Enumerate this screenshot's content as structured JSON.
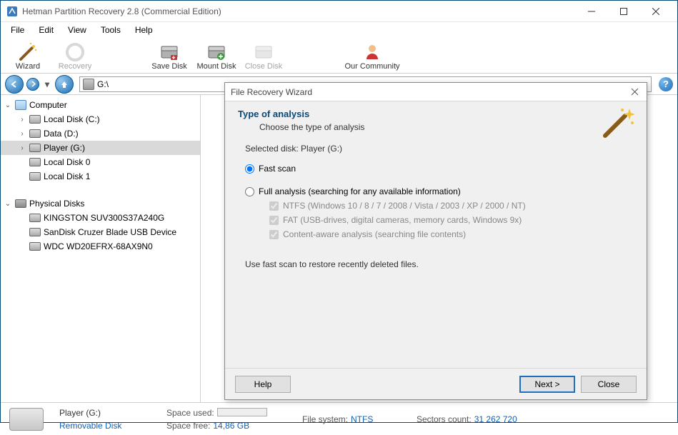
{
  "window": {
    "title": "Hetman Partition Recovery 2.8 (Commercial Edition)"
  },
  "menu": {
    "items": [
      "File",
      "Edit",
      "View",
      "Tools",
      "Help"
    ]
  },
  "toolbar": {
    "wizard": "Wizard",
    "recovery": "Recovery",
    "save_disk": "Save Disk",
    "mount_disk": "Mount Disk",
    "close_disk": "Close Disk",
    "community": "Our Community"
  },
  "address": {
    "path": "G:\\"
  },
  "tree": {
    "computer": "Computer",
    "items": [
      {
        "label": "Local Disk (C:)"
      },
      {
        "label": "Data (D:)"
      },
      {
        "label": "Player (G:)"
      },
      {
        "label": "Local Disk 0"
      },
      {
        "label": "Local Disk 1"
      }
    ],
    "physical": "Physical Disks",
    "phys_items": [
      {
        "label": "KINGSTON SUV300S37A240G"
      },
      {
        "label": "SanDisk Cruzer Blade USB Device"
      },
      {
        "label": "WDC WD20EFRX-68AX9N0"
      }
    ]
  },
  "status": {
    "name": "Player (G:)",
    "type": "Removable Disk",
    "space_used_label": "Space used:",
    "space_free_label": "Space free:",
    "space_free": "14,86 GB",
    "fs_label": "File system:",
    "fs": "NTFS",
    "sectors_label": "Sectors count:",
    "sectors": "31 262 720"
  },
  "dialog": {
    "title": "File Recovery Wizard",
    "heading": "Type of analysis",
    "sub": "Choose the type of analysis",
    "selected_label": "Selected disk: Player (G:)",
    "fast": "Fast scan",
    "full": "Full analysis (searching for any available information)",
    "ntfs": "NTFS (Windows 10 / 8 / 7 / 2008 / Vista / 2003 / XP / 2000 / NT)",
    "fat": "FAT (USB-drives, digital cameras, memory cards, Windows 9x)",
    "content": "Content-aware analysis (searching file contents)",
    "hint": "Use fast scan to restore recently deleted files.",
    "help": "Help",
    "next": "Next >",
    "close": "Close"
  }
}
